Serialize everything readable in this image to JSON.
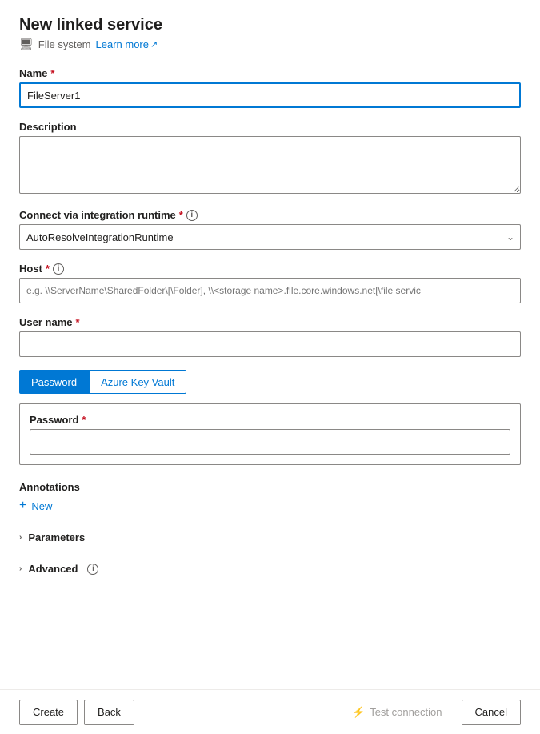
{
  "header": {
    "title": "New linked service",
    "subtitle": "File system",
    "learn_more": "Learn more",
    "external_link_icon": "↗"
  },
  "form": {
    "name_label": "Name",
    "name_value": "FileServer1",
    "description_label": "Description",
    "description_placeholder": "",
    "integration_runtime_label": "Connect via integration runtime",
    "integration_runtime_value": "AutoResolveIntegrationRuntime",
    "host_label": "Host",
    "host_placeholder": "e.g. \\\\ServerName\\SharedFolder\\[\\Folder], \\\\<storage name>.file.core.windows.net[\\file servic",
    "username_label": "User name",
    "username_value": "",
    "password_tab_label": "Password",
    "azure_key_vault_tab_label": "Azure Key Vault",
    "password_field_label": "Password",
    "password_value": ""
  },
  "annotations": {
    "label": "Annotations",
    "new_button": "New"
  },
  "parameters": {
    "label": "Parameters"
  },
  "advanced": {
    "label": "Advanced"
  },
  "footer": {
    "create_label": "Create",
    "back_label": "Back",
    "test_connection_label": "Test connection",
    "cancel_label": "Cancel"
  },
  "icons": {
    "file_system": "🖥",
    "info": "i",
    "chevron_down": "⌄",
    "chevron_right": "›",
    "plus": "+",
    "external_link": "↗",
    "test_connection": "⚡"
  }
}
